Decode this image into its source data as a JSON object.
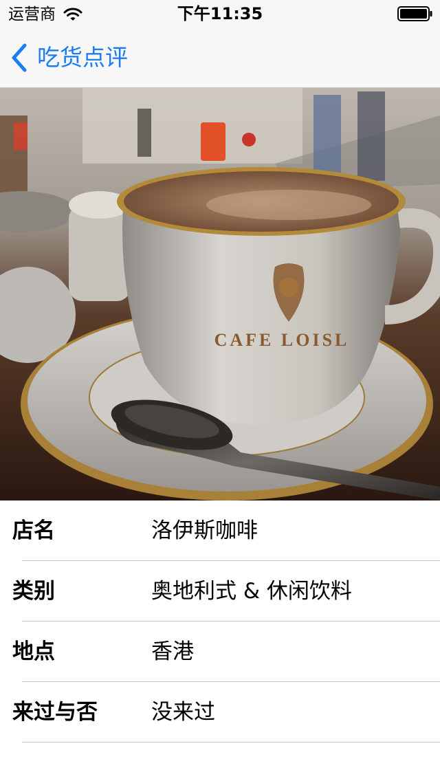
{
  "status_bar": {
    "carrier": "运营商",
    "time": "下午11:35",
    "wifi_icon": "wifi-icon",
    "battery_icon": "battery-icon"
  },
  "nav": {
    "back_icon": "chevron-left-icon",
    "back_label": "吃货点评",
    "accent_color": "#1a7cf5"
  },
  "hero_photo": {
    "image": "coffee-cup-photo",
    "cup_text": "CAFE LOISL"
  },
  "details": [
    {
      "label": "店名",
      "value": "洛伊斯咖啡"
    },
    {
      "label": "类别",
      "value": "奥地利式 & 休闲饮料"
    },
    {
      "label": "地点",
      "value": "香港"
    },
    {
      "label": "来过与否",
      "value": "没来过"
    }
  ]
}
